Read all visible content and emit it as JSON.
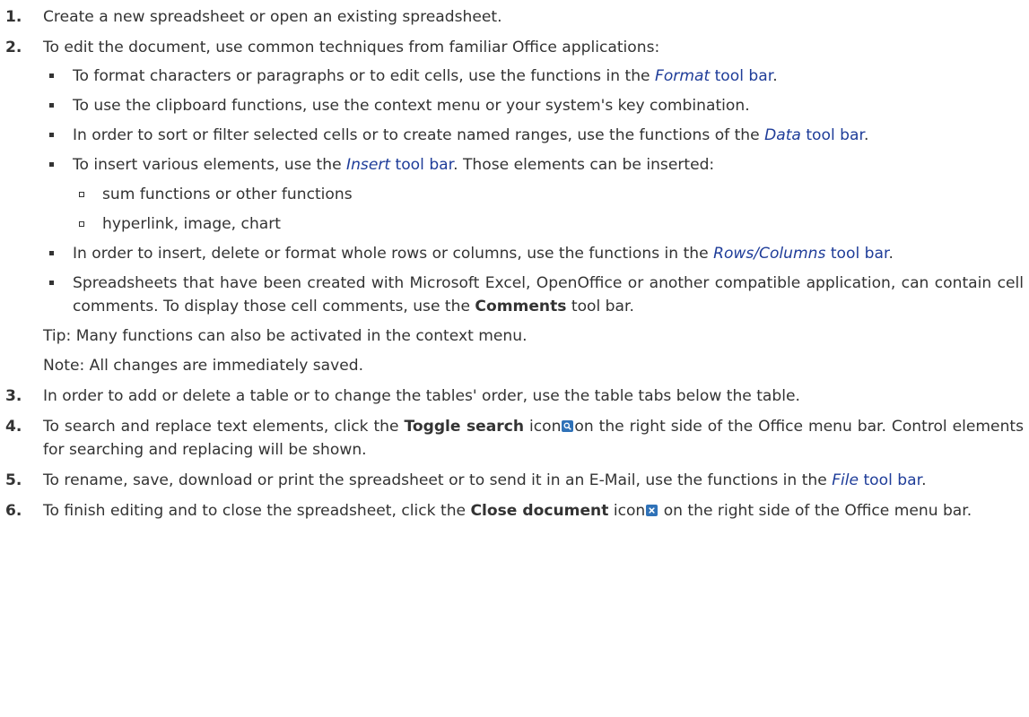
{
  "steps": [
    {
      "number": "1.",
      "text": "Create a new spreadsheet or open an existing spreadsheet."
    },
    {
      "number": "2.",
      "intro": "To edit the document, use common techniques from familiar Office applications:",
      "bullets": [
        {
          "before": "To format characters or paragraphs or to edit cells, use the functions in the ",
          "link_em": "Format",
          "link_rest": " tool bar",
          "after": "."
        },
        {
          "text": "To use the clipboard functions, use the context menu or your system's key combination."
        },
        {
          "before": "In order to sort or filter selected cells or to create named ranges, use the functions of the ",
          "link_em": "Data",
          "link_rest": " tool bar",
          "after": "."
        },
        {
          "before": "To insert various elements, use the ",
          "link_em": "Insert",
          "link_rest": " tool bar",
          "after": ". Those elements can be inserted:",
          "sub": [
            "sum functions or other functions",
            "hyperlink, image, chart"
          ]
        },
        {
          "before": "In order to insert, delete or format whole rows or columns, use the functions in the ",
          "link_em": "Rows/Columns",
          "link_rest": " tool bar",
          "after": "."
        },
        {
          "before": "Spreadsheets that have been created with Microsoft Excel, OpenOffice or another compatible application, can contain cell comments. To display those cell comments, use the ",
          "bold": "Comments",
          "after": " tool bar."
        }
      ],
      "tip": "Tip: Many functions can also be activated in the context menu.",
      "note": "Note: All changes are immediately saved."
    },
    {
      "number": "3.",
      "text": "In order to add or delete a table or to change the tables' order, use the table tabs below the table."
    },
    {
      "number": "4.",
      "before": "To search and replace text elements, click the ",
      "bold": "Toggle search",
      "mid": " icon",
      "icon": "search-icon",
      "after": "on the right side of the Office menu bar. Control elements for searching and replacing will be shown."
    },
    {
      "number": "5.",
      "before": "To rename, save, download or print the spreadsheet or to send it in an E-Mail, use the functions in the ",
      "link_em": "File",
      "link_rest": " tool bar",
      "after": "."
    },
    {
      "number": "6.",
      "before": "To finish editing and to close the spreadsheet, click the ",
      "bold": "Close document",
      "mid": " icon",
      "icon": "close-icon",
      "after": " on the right side of the Office menu bar."
    }
  ],
  "colors": {
    "text": "#333333",
    "link": "#1f3d99",
    "icon_bg": "#2f72b8"
  }
}
